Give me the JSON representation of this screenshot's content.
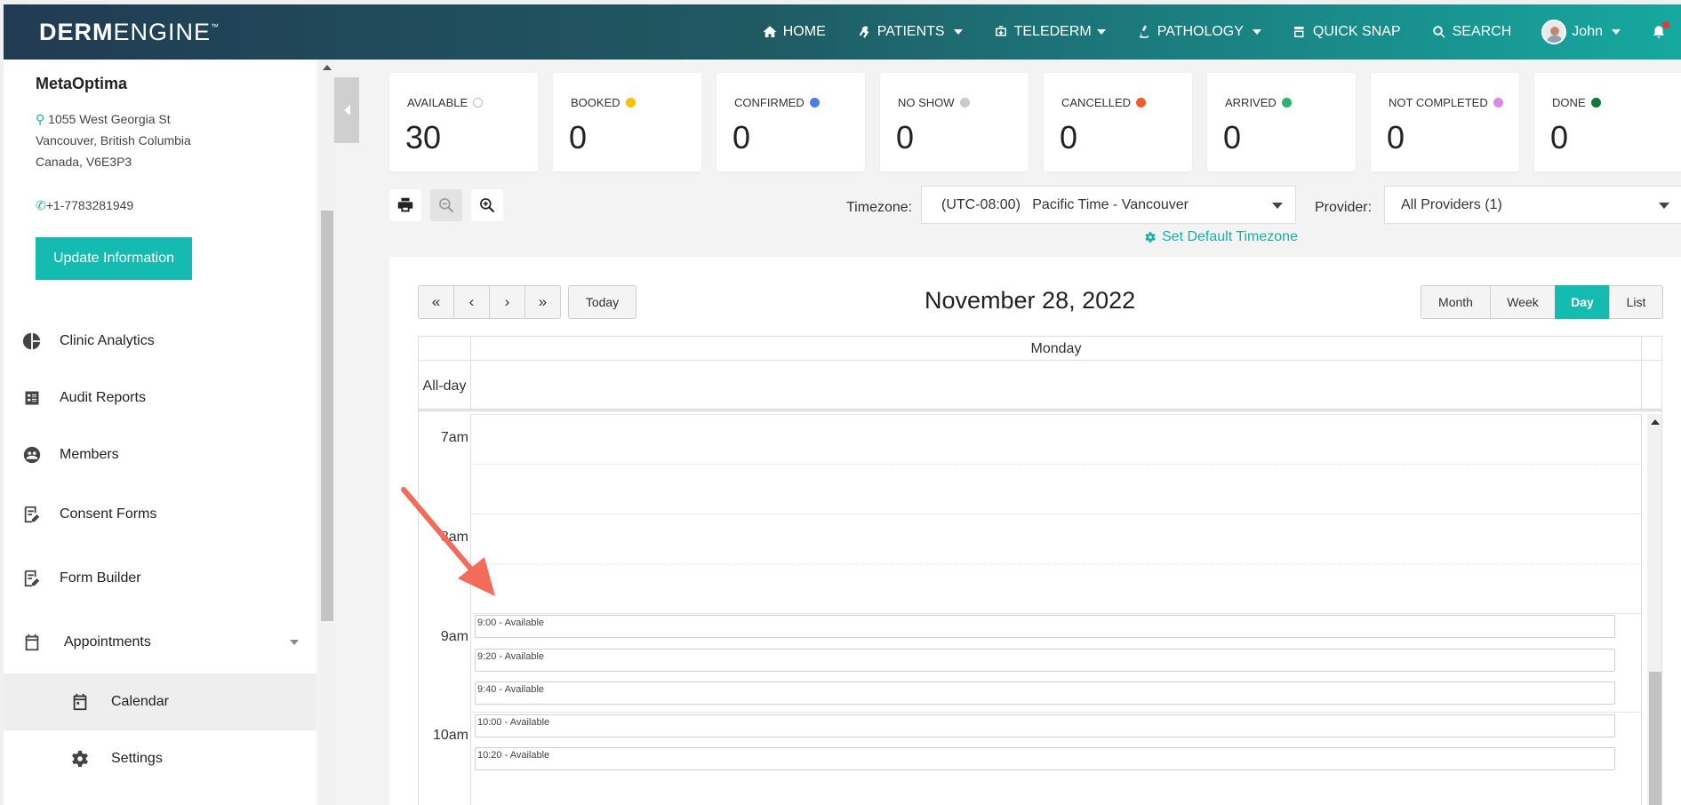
{
  "brand": {
    "bold": "DERM",
    "light": "ENGINE",
    "tm": "™"
  },
  "nav": {
    "home": "HOME",
    "patients": "PATIENTS",
    "telederm": "TELEDERM",
    "pathology": "PATHOLOGY",
    "quick_snap": "QUICK SNAP",
    "search": "SEARCH",
    "user": "John"
  },
  "clinic": {
    "name": "MetaOptima",
    "address_line1": "1055 West Georgia St",
    "address_line2": "Vancouver, British Columbia",
    "address_line3": "Canada, V6E3P3",
    "phone": "+1-7783281949",
    "update_label": "Update Information"
  },
  "menu": {
    "clinic_analytics": "Clinic Analytics",
    "audit_reports": "Audit Reports",
    "members": "Members",
    "consent_forms": "Consent Forms",
    "form_builder": "Form Builder",
    "appointments": "Appointments",
    "calendar": "Calendar",
    "settings": "Settings"
  },
  "status_cards": [
    {
      "label": "AVAILABLE",
      "value": "30",
      "color": "#ffffff",
      "ring": "#bbbbbb"
    },
    {
      "label": "BOOKED",
      "value": "0",
      "color": "#f5c000"
    },
    {
      "label": "CONFIRMED",
      "value": "0",
      "color": "#4a7fe6"
    },
    {
      "label": "NO SHOW",
      "value": "0",
      "color": "#c9c9c9"
    },
    {
      "label": "CANCELLED",
      "value": "0",
      "color": "#f05a28"
    },
    {
      "label": "ARRIVED",
      "value": "0",
      "color": "#2fb36a"
    },
    {
      "label": "NOT COMPLETED",
      "value": "0",
      "color": "#d98ae8"
    },
    {
      "label": "DONE",
      "value": "0",
      "color": "#0f7a3c"
    }
  ],
  "toolbar": {
    "timezone_label": "Timezone:",
    "timezone_value": "(UTC-08:00)   Pacific Time - Vancouver",
    "set_default": "Set Default Timezone",
    "provider_label": "Provider:",
    "provider_value": "All Providers (1)"
  },
  "calendar": {
    "nav_first": "«",
    "nav_prev": "‹",
    "nav_next": "›",
    "nav_last": "»",
    "today": "Today",
    "title": "November 28, 2022",
    "views": [
      "Month",
      "Week",
      "Day",
      "List"
    ],
    "active_view": "Day",
    "day_name": "Monday",
    "all_day": "All-day",
    "hours": [
      "7am",
      "8am",
      "9am",
      "10am"
    ],
    "events": [
      "9:00 - Available",
      "9:20 - Available",
      "9:40 - Available",
      "10:00 - Available",
      "10:20 - Available"
    ]
  },
  "colors": {
    "accent": "#14bbb0",
    "annotation": "#f26b5b"
  }
}
